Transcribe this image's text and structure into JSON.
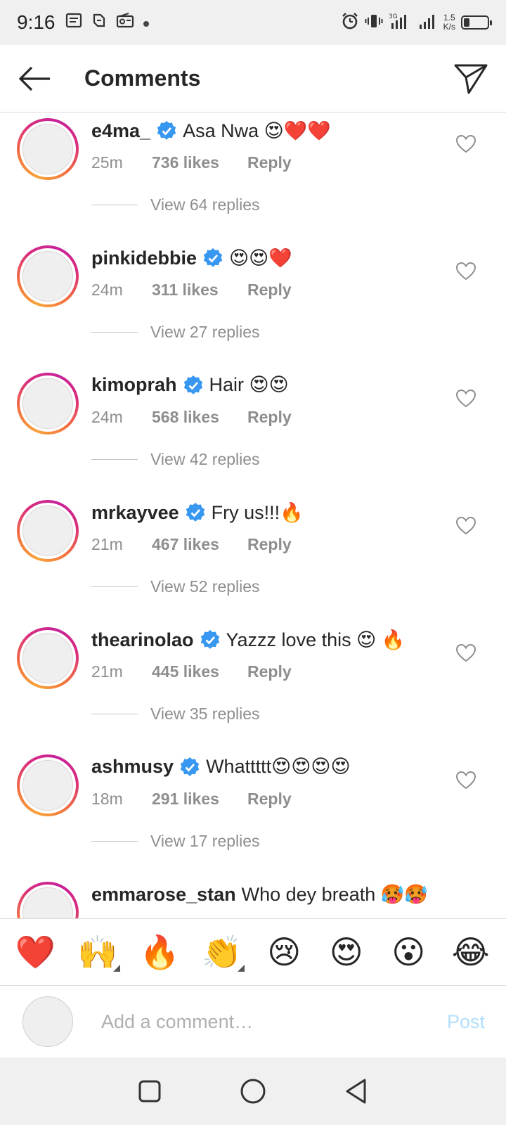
{
  "status": {
    "time": "9:16",
    "net_speed": "1.5\nK/s",
    "network": "3G"
  },
  "header": {
    "title": "Comments"
  },
  "comments": [
    {
      "user": "e4ma_",
      "text": "Asa Nwa 😍❤️❤️",
      "time": "25m",
      "likes": "736 likes",
      "reply": "Reply",
      "view_replies": "View 64 replies"
    },
    {
      "user": "pinkidebbie",
      "text": "😍😍❤️",
      "time": "24m",
      "likes": "311 likes",
      "reply": "Reply",
      "view_replies": "View 27 replies"
    },
    {
      "user": "kimoprah",
      "text": "Hair 😍😍",
      "time": "24m",
      "likes": "568 likes",
      "reply": "Reply",
      "view_replies": "View 42 replies"
    },
    {
      "user": "mrkayvee",
      "text": "Fry us!!!🔥",
      "time": "21m",
      "likes": "467 likes",
      "reply": "Reply",
      "view_replies": "View 52 replies"
    },
    {
      "user": "thearinolao",
      "text": "Yazzz love this 😍 🔥",
      "time": "21m",
      "likes": "445 likes",
      "reply": "Reply",
      "view_replies": "View 35 replies"
    },
    {
      "user": "ashmusy",
      "text": "Whattttt😍😍😍😍",
      "time": "18m",
      "likes": "291 likes",
      "reply": "Reply",
      "view_replies": "View 17 replies"
    },
    {
      "user": "emmarose_stan",
      "text": "Who dey breath 🥵🥵"
    }
  ],
  "emoji_bar": {
    "items": [
      {
        "glyph": "❤️",
        "icon": "red-heart-emoji"
      },
      {
        "glyph": "🙌",
        "icon": "raising-hands-emoji"
      },
      {
        "glyph": "🔥",
        "icon": "fire-emoji"
      },
      {
        "glyph": "👏",
        "icon": "clapping-hands-emoji"
      },
      {
        "glyph": "😢",
        "icon": "crying-face-emoji"
      },
      {
        "glyph": "😍",
        "icon": "heart-eyes-emoji"
      },
      {
        "glyph": "😮",
        "icon": "surprised-face-emoji"
      },
      {
        "glyph": "😂",
        "icon": "tears-of-joy-emoji"
      }
    ]
  },
  "composer": {
    "placeholder": "Add a comment…",
    "post_label": "Post"
  },
  "colors": {
    "verified": "#3897f0",
    "secondary_text": "#8e8e8e",
    "post_disabled": "#b2dffc"
  }
}
